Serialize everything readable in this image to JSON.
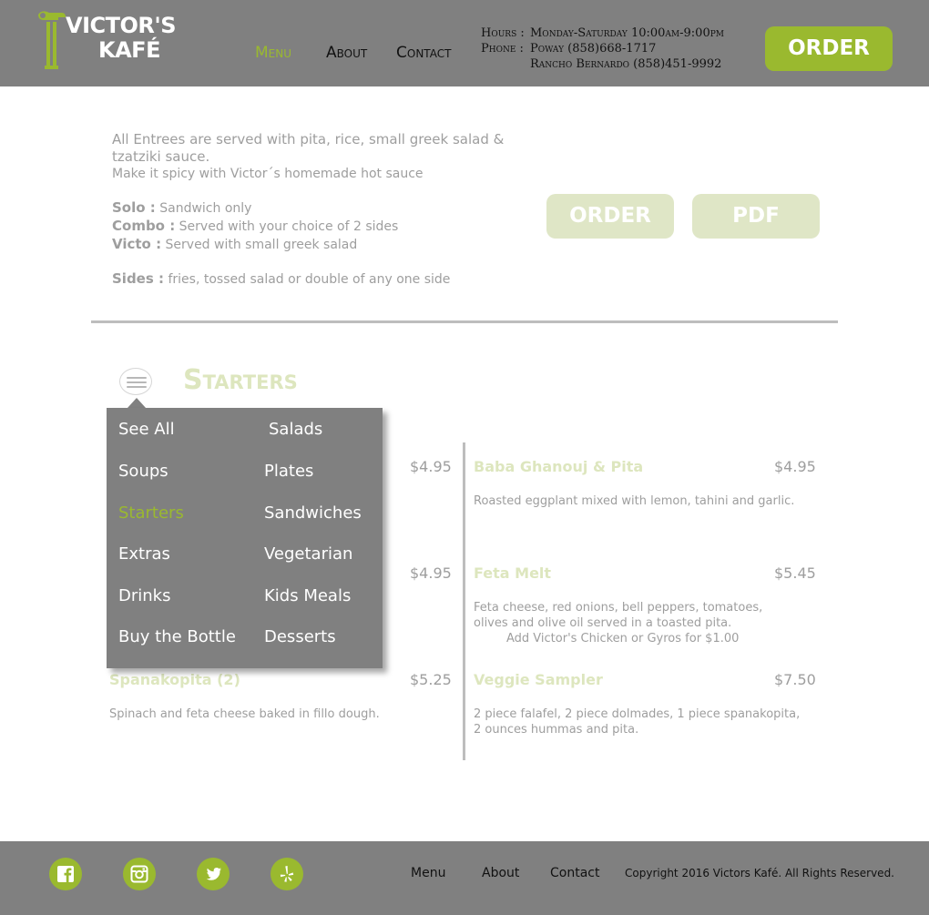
{
  "brand": {
    "line1": "VICTOR'S",
    "line2": "KAFÉ",
    "accent": "#9ab92f",
    "pale_accent": "#dde6be",
    "header_bg": "#808080"
  },
  "nav": {
    "items": [
      "Menu",
      "About",
      "Contact"
    ],
    "active": "Menu"
  },
  "hours": {
    "hours_label": "Hours :",
    "hours_value": "Monday-Saturday 10:00am-9:00pm",
    "phone_label": "Phone :",
    "phone_poway": "Poway (858)668-1717",
    "phone_rb": "Rancho Bernardo (858)451-9992"
  },
  "header_order_label": "ORDER",
  "intro": {
    "line1": "All Entrees are served with pita, rice, small greek salad & tzatziki sauce.",
    "line2": "Make it spicy with Victor´s homemade hot sauce",
    "solo_label": "Solo :",
    "solo_text": " Sandwich only",
    "combo_label": "Combo :",
    "combo_text": " Served with your choice of 2 sides",
    "victo_label": "Victo :",
    "victo_text": " Served with small greek salad",
    "sides_label": "Sides :",
    "sides_text": " fries, tossed salad or double of any one side"
  },
  "actions": {
    "order_label": "ORDER",
    "pdf_label": "PDF"
  },
  "section": {
    "title": "Starters",
    "menu_icon": "hamburger-menu-icon"
  },
  "dropdown": {
    "left": [
      "See All",
      "Soups",
      "Starters",
      "Extras",
      "Drinks",
      "Buy the Bottle"
    ],
    "right": [
      "Salads",
      "Plates",
      "Sandwiches",
      "Vegetarian",
      "Kids Meals",
      "Desserts"
    ],
    "active": "Starters"
  },
  "items_left": [
    {
      "price": "$4.95"
    },
    {
      "price": "$4.95"
    },
    {
      "name": "Spanakopita (2)",
      "price": "$5.25",
      "desc": "Spinach and feta cheese baked in fillo dough."
    }
  ],
  "items_right": [
    {
      "name": "Baba Ghanouj & Pita",
      "price": "$4.95",
      "desc": "Roasted eggplant mixed with lemon, tahini and garlic."
    },
    {
      "name": "Feta Melt",
      "price": "$5.45",
      "desc1": "Feta cheese, red onions, bell peppers, tomatoes,",
      "desc2": "olives and olive oil served in a toasted pita.",
      "desc3": "Add Victor's Chicken or Gyros for $1.00"
    },
    {
      "name": "Veggie Sampler",
      "price": "$7.50",
      "desc1": "2 piece falafel, 2 piece dolmades, 1 piece spanakopita,",
      "desc2": "2 ounces hummas and pita."
    }
  ],
  "footer": {
    "social": [
      "facebook-icon",
      "instagram-icon",
      "twitter-icon",
      "yelp-icon"
    ],
    "links": [
      "Menu",
      "About",
      "Contact"
    ],
    "copyright": "Copyright 2016 Victors Kafé. All Rights Reserved."
  }
}
